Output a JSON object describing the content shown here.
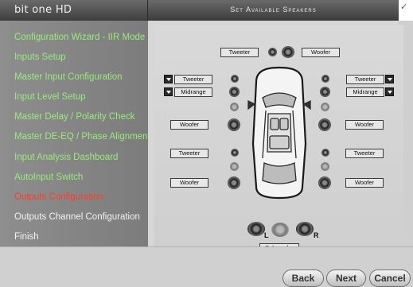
{
  "app": {
    "brand": "bit one HD"
  },
  "header": {
    "title": "Set Available Speakers"
  },
  "sidebar": {
    "items": [
      {
        "label": "Configuration Wizard - IIR Mode",
        "state": "done"
      },
      {
        "label": "Inputs Setup",
        "state": "done"
      },
      {
        "label": "Master Input Configuration",
        "state": "done"
      },
      {
        "label": "Input Level Setup",
        "state": "done"
      },
      {
        "label": "Master Delay / Polarity Check",
        "state": "done"
      },
      {
        "label": "Master DE-EQ / Phase Alignment",
        "state": "done"
      },
      {
        "label": "Input Analysis Dashboard",
        "state": "done"
      },
      {
        "label": "AutoInput Switch",
        "state": "done"
      },
      {
        "label": "Outputs Configuration",
        "state": "current"
      },
      {
        "label": "Outputs Channel Configuration",
        "state": "pending"
      },
      {
        "label": "Finish",
        "state": "pending"
      }
    ]
  },
  "speakers": {
    "center_tweeter": "Tweeter",
    "center_woofer": "Woofer",
    "front_left_tweeter": "Tweeter",
    "front_left_midrange": "Midrange",
    "front_left_woofer": "Woofer",
    "front_right_tweeter": "Tweeter",
    "front_right_midrange": "Midrange",
    "front_right_woofer": "Woofer",
    "rear_left_tweeter": "Tweeter",
    "rear_left_woofer": "Woofer",
    "rear_right_tweeter": "Tweeter",
    "rear_right_woofer": "Woofer",
    "subwoofer": "Subwoofer",
    "sub_left_marker": "L",
    "sub_right_marker": "R"
  },
  "footer": {
    "back_label": "Back",
    "next_label": "Next",
    "cancel_label": "Cancel"
  },
  "colors": {
    "done": "#9aea7d",
    "current": "#ff3c2a",
    "pending": "#f2f2f2"
  }
}
